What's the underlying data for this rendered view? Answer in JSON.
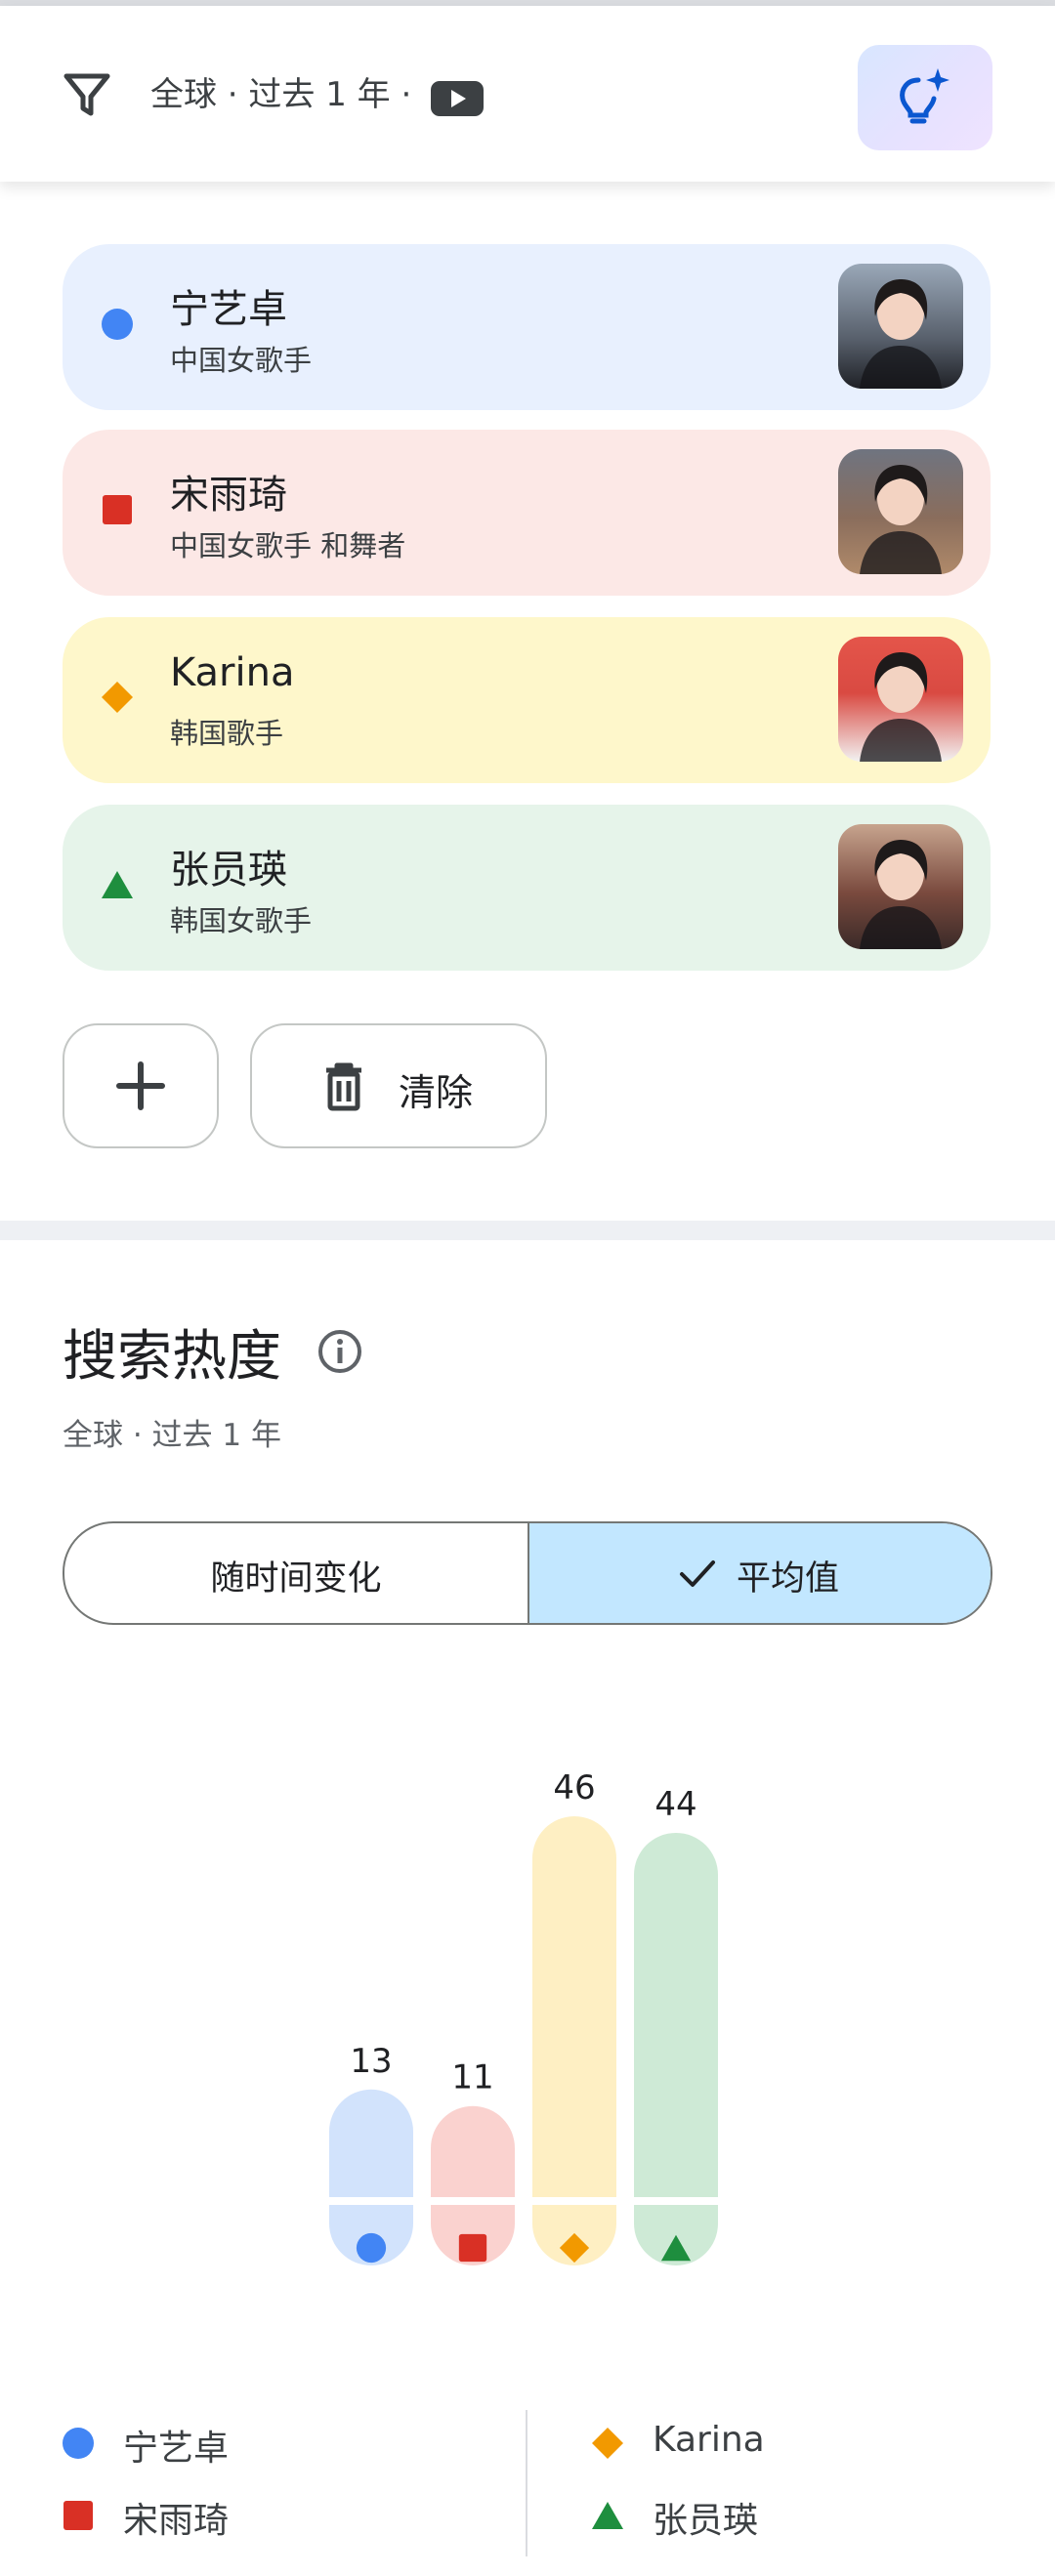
{
  "header": {
    "filter_text": "全球 · 过去 1 年 ·",
    "filter_icon": "filter-icon",
    "source_icon": "youtube-icon",
    "idea_icon": "lightbulb-sparkle-icon"
  },
  "terms": [
    {
      "name": "宁艺卓",
      "desc": "中国女歌手",
      "color": "#4285f4",
      "bg": "#e8f0fe",
      "marker": "circle"
    },
    {
      "name": "宋雨琦",
      "desc": "中国女歌手 和舞者",
      "color": "#d93025",
      "bg": "#fce8e6",
      "marker": "square"
    },
    {
      "name": "Karina",
      "desc": "韩国歌手",
      "color": "#f29900",
      "bg": "#fef7cb",
      "marker": "diamond"
    },
    {
      "name": "张员瑛",
      "desc": "韩国女歌手",
      "color": "#1e8e3e",
      "bg": "#e6f4ea",
      "marker": "triangle"
    }
  ],
  "actions": {
    "add_icon": "plus-icon",
    "clear_icon": "trash-icon",
    "clear_label": "清除"
  },
  "section": {
    "title": "搜索热度",
    "subtitle": "全球 · 过去 1 年",
    "info_icon": "info-icon"
  },
  "toggle": {
    "over_time_label": "随时间变化",
    "average_label": "平均值",
    "selected": "average",
    "check_icon": "check-icon"
  },
  "chart_data": {
    "type": "bar",
    "categories": [
      "宁艺卓",
      "宋雨琦",
      "Karina",
      "张员瑛"
    ],
    "values": [
      13,
      11,
      46,
      44
    ],
    "value_labels": [
      "13",
      "11",
      "46",
      "44"
    ],
    "bar_colors": [
      "#d2e3fc",
      "#fad2cf",
      "#feefc3",
      "#ceead6"
    ],
    "marker_colors": [
      "#4285f4",
      "#d93025",
      "#f29900",
      "#1e8e3e"
    ],
    "markers": [
      "circle",
      "square",
      "diamond",
      "triangle"
    ],
    "ylim": [
      0,
      50
    ],
    "grid": false,
    "legend": "bottom"
  },
  "legend": [
    {
      "label": "宁艺卓",
      "marker": "circle",
      "color": "#4285f4"
    },
    {
      "label": "宋雨琦",
      "marker": "square",
      "color": "#d93025"
    },
    {
      "label": "Karina",
      "marker": "diamond",
      "color": "#f29900"
    },
    {
      "label": "张员瑛",
      "marker": "triangle",
      "color": "#1e8e3e"
    }
  ]
}
